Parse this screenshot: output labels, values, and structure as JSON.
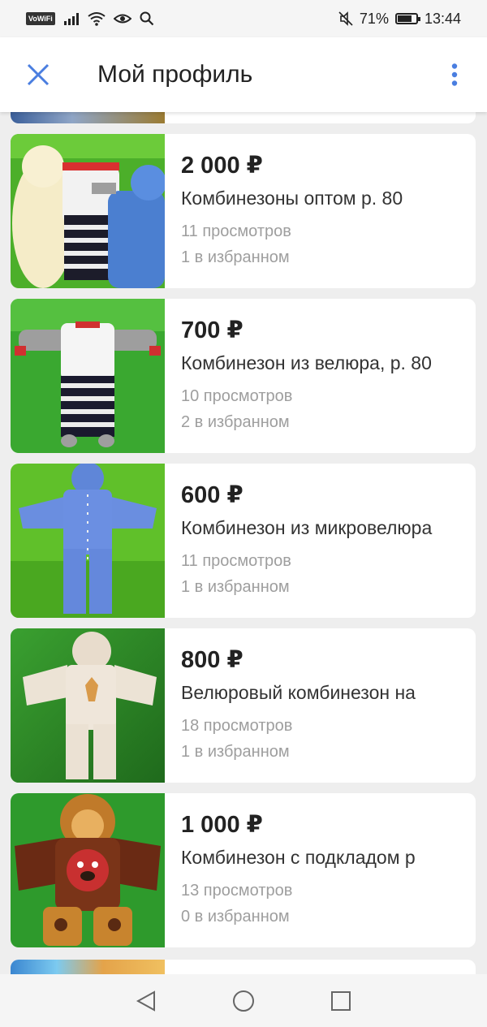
{
  "status_bar": {
    "vowifi": "VoWiFi",
    "battery_percent": "71%",
    "time": "13:44",
    "battery_level": 0.71
  },
  "app_bar": {
    "title": "Мой профиль",
    "close_icon": "close-icon",
    "menu_icon": "more-vertical-icon",
    "accent_color": "#4a7ee0"
  },
  "listings": [
    {
      "price": "2 000 ₽",
      "title": "Комбинезоны оптом р. 80",
      "views": "11 просмотров",
      "favorites": "1 в избранном"
    },
    {
      "price": "700 ₽",
      "title": "Комбинезон из велюра, р. 80",
      "views": "10 просмотров",
      "favorites": "2 в избранном"
    },
    {
      "price": "600 ₽",
      "title": "Комбинезон из микровелюра",
      "views": "11 просмотров",
      "favorites": "1 в избранном"
    },
    {
      "price": "800 ₽",
      "title": "Велюровый комбинезон на",
      "views": "18 просмотров",
      "favorites": "1 в избранном"
    },
    {
      "price": "1 000 ₽",
      "title": "Комбинезон с подкладом р",
      "views": "13 просмотров",
      "favorites": "0 в избранном"
    }
  ],
  "nav_bar": {
    "back_icon": "back-triangle-icon",
    "home_icon": "home-circle-icon",
    "recents_icon": "recents-square-icon"
  }
}
